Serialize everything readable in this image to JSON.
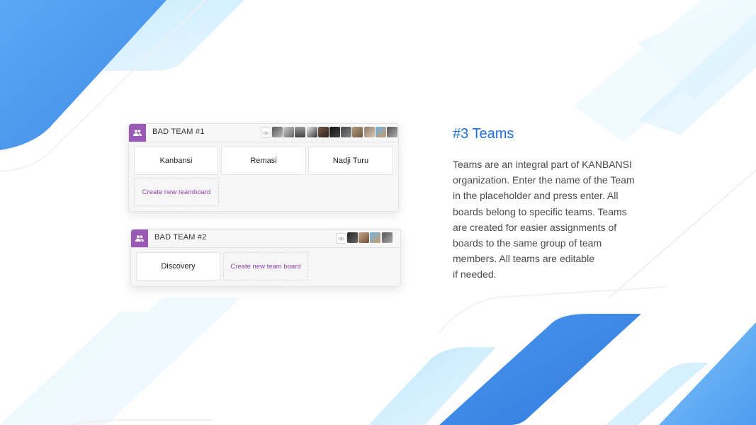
{
  "colors": {
    "accent_blue": "#1e6fd9",
    "team_icon_purple": "#9b59b6",
    "create_link_purple": "#8e44ad"
  },
  "teams": [
    {
      "name": "BAD TEAM #1",
      "icon": "team-people-icon",
      "watch_icon": "eye-icon",
      "member_avatar_count": 11,
      "boards": [
        "Kanbansi",
        "Remasi",
        "Nadji Turu"
      ],
      "create_label": "Create new teamboard"
    },
    {
      "name": "BAD TEAM #2",
      "icon": "team-people-icon",
      "watch_icon": "eye-icon",
      "member_avatar_count": 4,
      "boards": [
        "Discovery"
      ],
      "create_label": "Create new team board"
    }
  ],
  "info": {
    "title": "#3 Teams",
    "lines": [
      "Teams are an integral part of KANBANSI",
      "organization. Enter the name of the Team",
      "in the placeholder and press enter. All",
      "boards belong to specific teams. Teams",
      "are created for easier assignments of",
      "boards to the same group of team",
      "members. All teams are editable",
      "if needed."
    ]
  }
}
